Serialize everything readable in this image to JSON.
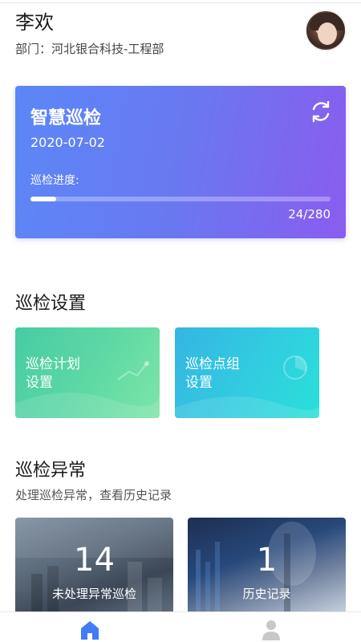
{
  "user": {
    "name": "李欢",
    "department": "部门：河北银合科技-工程部"
  },
  "hero": {
    "title": "智慧巡检",
    "date": "2020-07-02",
    "progress_label": "巡检进度:",
    "progress_done": 24,
    "progress_total": 280,
    "progress_text": "24/280"
  },
  "settings": {
    "title": "巡检设置",
    "cards": [
      {
        "label": "巡检计划\n设置"
      },
      {
        "label": "巡检点组\n设置"
      }
    ]
  },
  "abnormal": {
    "title": "巡检异常",
    "subtitle": "处理巡检异常，查看历史记录",
    "cards": [
      {
        "number": "14",
        "caption": "未处理异常巡检"
      },
      {
        "number": "1",
        "caption": "历史记录"
      }
    ]
  },
  "colors": {
    "hero_start": "#5b87f7",
    "hero_end": "#8a5cef",
    "plan_card": "#5fd9a4",
    "point_card": "#31cfe0",
    "tab_active": "#3f7cf5",
    "tab_inactive": "#c8c8c8"
  },
  "tabbar": {
    "items": [
      {
        "icon": "home-icon",
        "active": true
      },
      {
        "icon": "user-icon",
        "active": false
      }
    ]
  }
}
